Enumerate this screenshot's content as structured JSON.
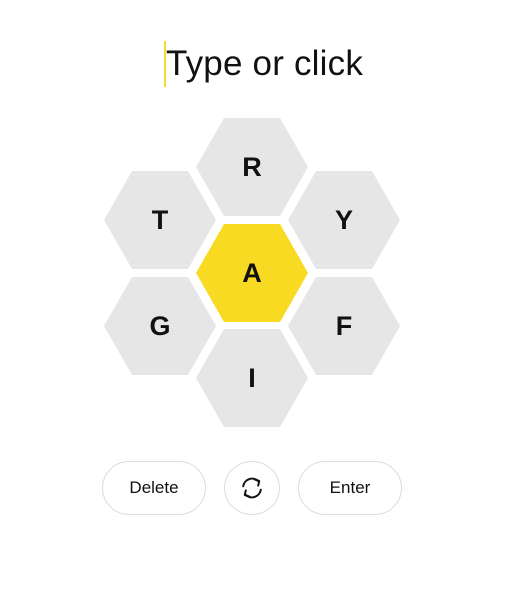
{
  "input": {
    "placeholder": "Type or click",
    "caret_color": "#f7da21"
  },
  "hive": {
    "center": {
      "letter": "A",
      "color": "#f8da22"
    },
    "outer": [
      {
        "position": "top",
        "letter": "R"
      },
      {
        "position": "upper-left",
        "letter": "T"
      },
      {
        "position": "upper-right",
        "letter": "Y"
      },
      {
        "position": "lower-left",
        "letter": "G"
      },
      {
        "position": "lower-right",
        "letter": "F"
      },
      {
        "position": "bottom",
        "letter": "I"
      }
    ],
    "outer_color": "#e6e6e6"
  },
  "controls": {
    "delete_label": "Delete",
    "shuffle_icon": "shuffle-icon",
    "enter_label": "Enter"
  }
}
